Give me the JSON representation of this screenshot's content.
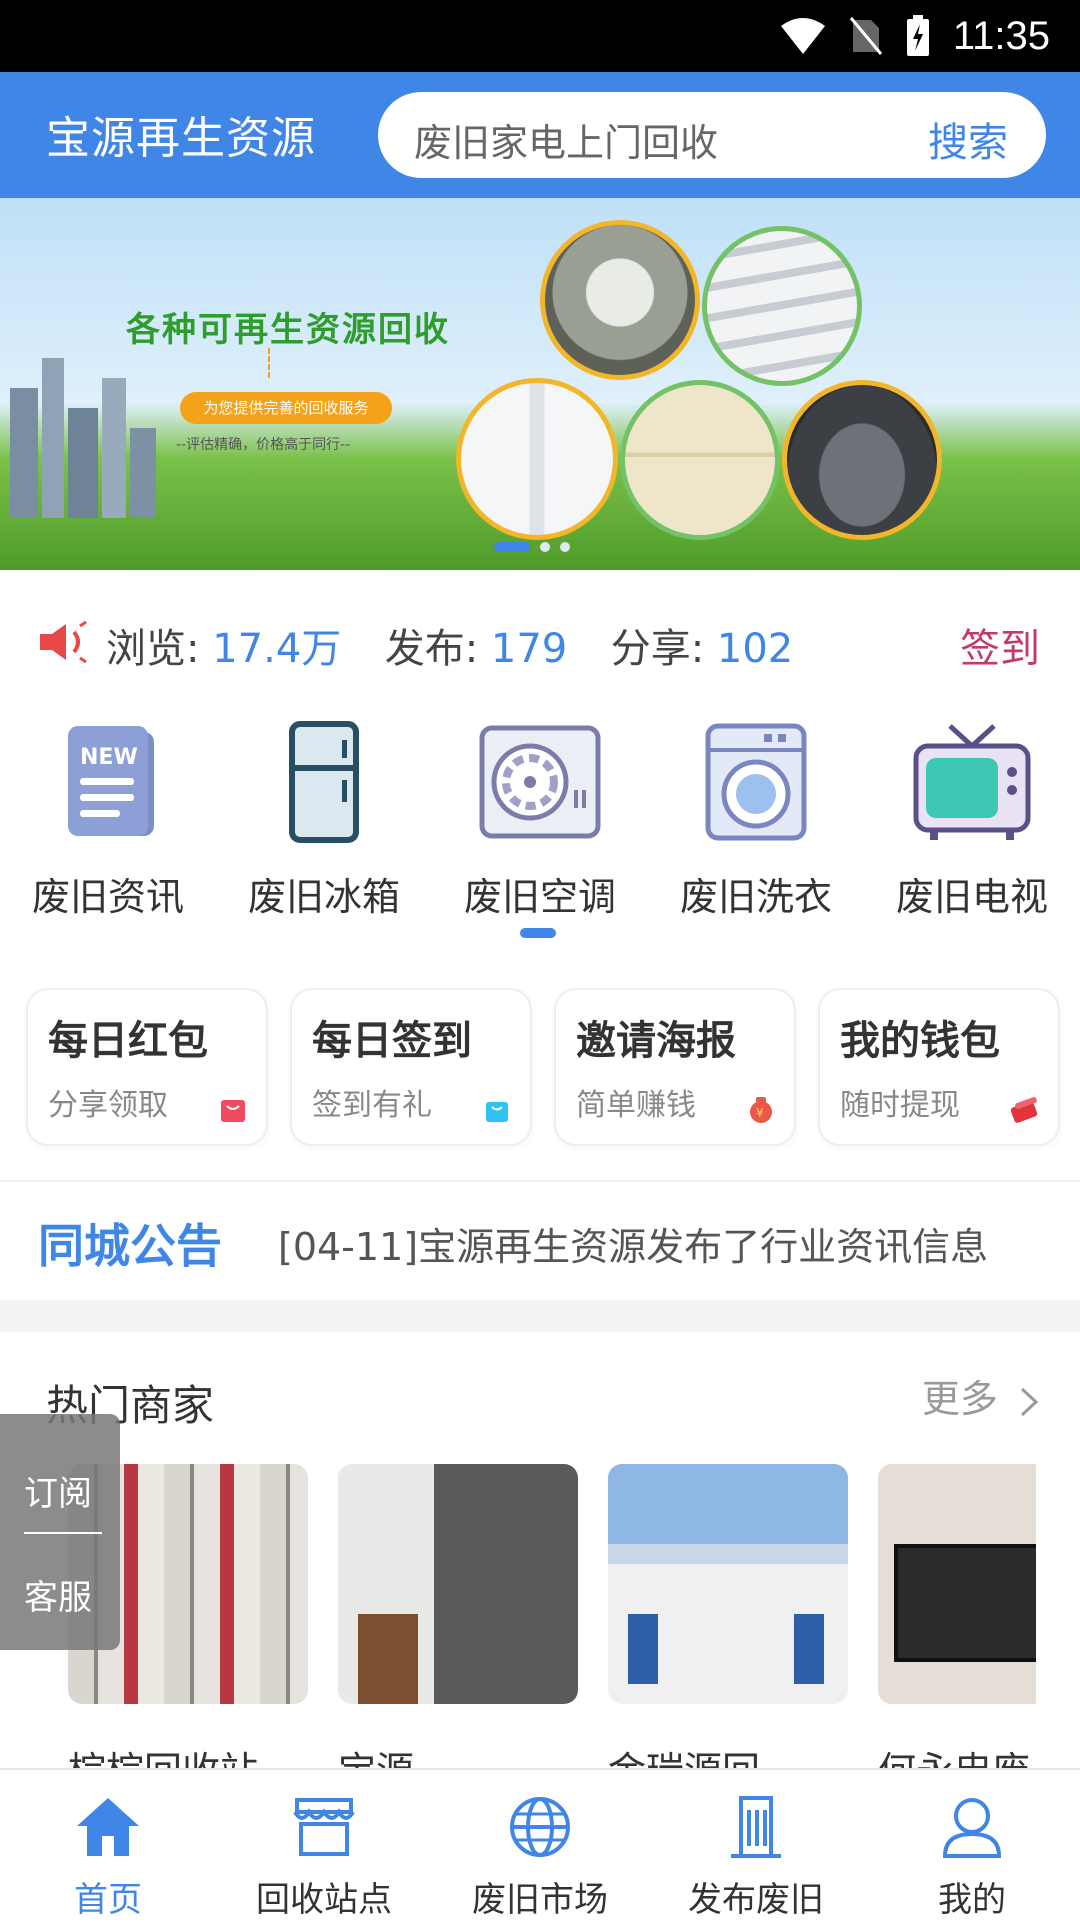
{
  "status_bar": {
    "time": "11:35"
  },
  "header": {
    "brand": "宝源再生资源",
    "search_placeholder": "废旧家电上门回收",
    "search_button": "搜索"
  },
  "banner": {
    "headline": "各种可再生资源回收",
    "tagline": "为您提供完善的回收服务",
    "slogan": "--评估精确，价格高于同行--",
    "active_slide": 1,
    "slide_count": 3
  },
  "stats": {
    "views_label": "浏览:",
    "views": "17.4万",
    "posts_label": "发布:",
    "posts": "179",
    "shares_label": "分享:",
    "shares": "102",
    "checkin": "签到"
  },
  "categories": [
    {
      "label": "废旧资讯",
      "icon": "news-icon"
    },
    {
      "label": "废旧冰箱",
      "icon": "fridge-icon"
    },
    {
      "label": "废旧空调",
      "icon": "air-conditioner-icon"
    },
    {
      "label": "废旧洗衣",
      "icon": "washing-machine-icon"
    },
    {
      "label": "废旧电视",
      "icon": "tv-icon"
    }
  ],
  "cards": [
    {
      "title": "每日红包",
      "subtitle": "分享领取",
      "icon": "red-bag-icon"
    },
    {
      "title": "每日签到",
      "subtitle": "签到有礼",
      "icon": "gift-bag-icon"
    },
    {
      "title": "邀请海报",
      "subtitle": "简单赚钱",
      "icon": "money-bag-icon"
    },
    {
      "title": "我的钱包",
      "subtitle": "随时提现",
      "icon": "wallet-icon"
    }
  ],
  "notice": {
    "tag": "同城公告",
    "message": "[04-11]宝源再生资源发布了行业资讯信息"
  },
  "hot": {
    "title": "热门商家",
    "more": "更多",
    "merchants": [
      {
        "name": "棕棕回收站"
      },
      {
        "name": "宝源"
      },
      {
        "name": "金瑞源回…"
      },
      {
        "name": "何永忠废"
      }
    ]
  },
  "side_tab": {
    "subscribe": "订阅",
    "service": "客服"
  },
  "tabbar": [
    {
      "label": "首页",
      "icon": "home-icon",
      "active": true
    },
    {
      "label": "回收站点",
      "icon": "store-icon",
      "active": false
    },
    {
      "label": "废旧市场",
      "icon": "globe-icon",
      "active": false
    },
    {
      "label": "发布废旧",
      "icon": "building-icon",
      "active": false
    },
    {
      "label": "我的",
      "icon": "user-icon",
      "active": false
    }
  ],
  "colors": {
    "primary": "#3f86e6",
    "checkin": "#c23b64"
  }
}
